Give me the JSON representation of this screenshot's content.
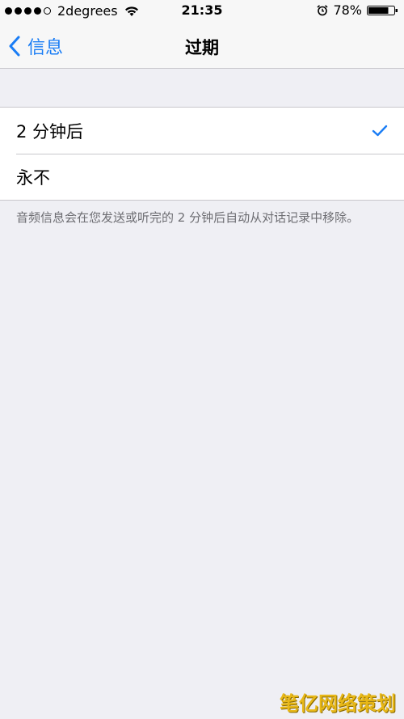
{
  "status_bar": {
    "carrier": "2degrees",
    "time": "21:35",
    "battery": "78%"
  },
  "nav": {
    "back_label": "信息",
    "title": "过期"
  },
  "options": [
    {
      "label": "2 分钟后",
      "selected": true
    },
    {
      "label": "永不",
      "selected": false
    }
  ],
  "footnote": "音频信息会在您发送或听完的 2 分钟后自动从对话记录中移除。",
  "watermark": "笔亿网络策划",
  "colors": {
    "accent": "#1a7df5",
    "background": "#efeff4",
    "footnote": "#6d6d72"
  }
}
